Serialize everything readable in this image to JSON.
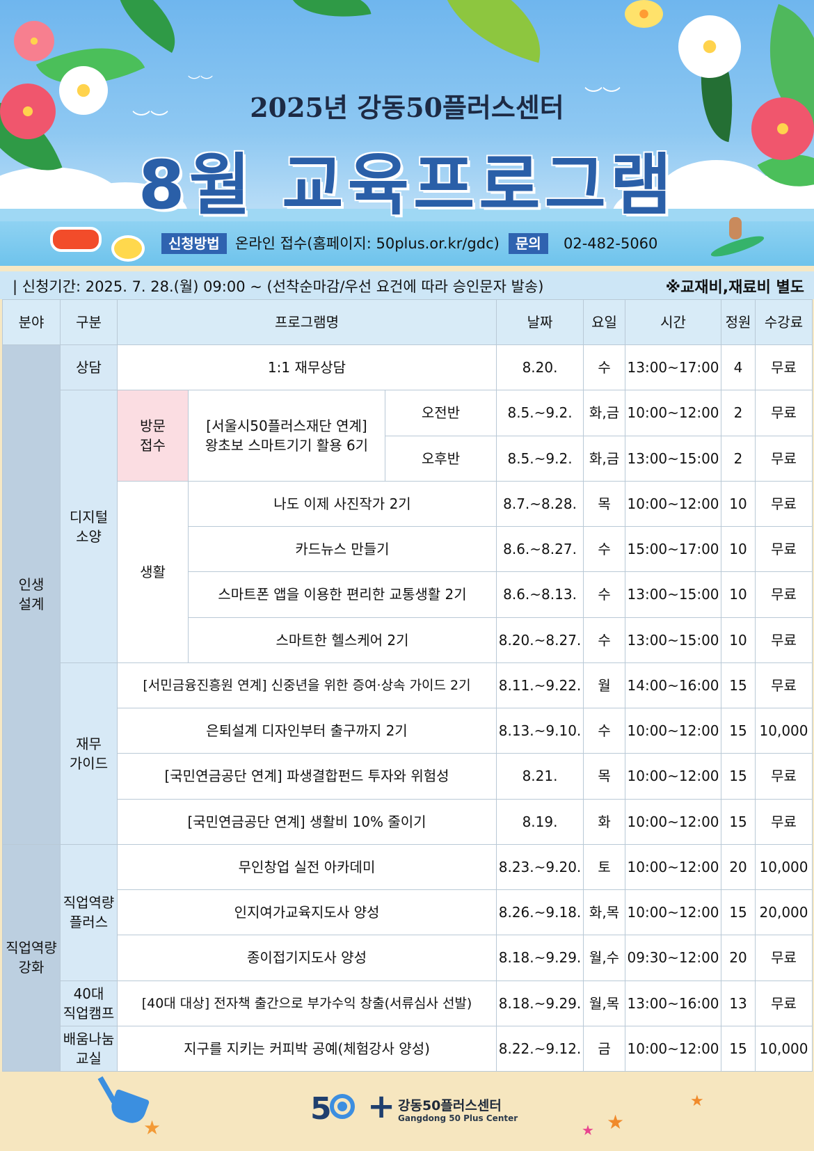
{
  "header": {
    "subtitle": "2025년 강동50플러스센터",
    "title": "8월 교육프로그램"
  },
  "contact": {
    "method_label": "신청방법",
    "method_text": "온라인 접수(홈페이지: 50plus.or.kr/gdc)",
    "inquiry_label": "문의",
    "inquiry_phone": "02-482-5060"
  },
  "period": {
    "text": "| 신청기간: 2025. 7. 28.(월) 09:00 ~ (선착순마감/우선 요건에 따라 승인문자 발송)",
    "note": "※교재비,재료비 별도"
  },
  "table": {
    "headers": {
      "field": "분야",
      "category": "구분",
      "program": "프로그램명",
      "date": "날짜",
      "day": "요일",
      "time": "시간",
      "capacity": "정원",
      "fee": "수강료"
    },
    "fields": {
      "life": "인생\n설계",
      "career": "직업역량\n강화"
    },
    "categories": {
      "counsel": "상담",
      "digital": "디지털\n소양",
      "visit": "방문\n접수",
      "living": "생활",
      "finance": "재무\n가이드",
      "career_plus": "직업역량\n플러스",
      "camp40": "40대\n직업캠프",
      "sharing": "배움나눔\n교실"
    },
    "rows": [
      {
        "program": "1:1 재무상담",
        "date": "8.20.",
        "day": "수",
        "time": "13:00~17:00",
        "cap": "4",
        "fee": "무료"
      },
      {
        "program": "[서울시50플러스재단 연계]\n왕초보 스마트기기 활용 6기",
        "session": "오전반",
        "date": "8.5.~9.2.",
        "day": "화,금",
        "time": "10:00~12:00",
        "cap": "2",
        "fee": "무료"
      },
      {
        "session": "오후반",
        "date": "8.5.~9.2.",
        "day": "화,금",
        "time": "13:00~15:00",
        "cap": "2",
        "fee": "무료"
      },
      {
        "program": "나도 이제 사진작가 2기",
        "date": "8.7.~8.28.",
        "day": "목",
        "time": "10:00~12:00",
        "cap": "10",
        "fee": "무료"
      },
      {
        "program": "카드뉴스 만들기",
        "date": "8.6.~8.27.",
        "day": "수",
        "time": "15:00~17:00",
        "cap": "10",
        "fee": "무료"
      },
      {
        "program": "스마트폰 앱을 이용한 편리한 교통생활 2기",
        "date": "8.6.~8.13.",
        "day": "수",
        "time": "13:00~15:00",
        "cap": "10",
        "fee": "무료"
      },
      {
        "program": "스마트한 헬스케어 2기",
        "date": "8.20.~8.27.",
        "day": "수",
        "time": "13:00~15:00",
        "cap": "10",
        "fee": "무료"
      },
      {
        "program": "[서민금융진흥원 연계] 신중년을 위한 증여·상속 가이드 2기",
        "date": "8.11.~9.22.",
        "day": "월",
        "time": "14:00~16:00",
        "cap": "15",
        "fee": "무료"
      },
      {
        "program": "은퇴설계 디자인부터 출구까지 2기",
        "date": "8.13.~9.10.",
        "day": "수",
        "time": "10:00~12:00",
        "cap": "15",
        "fee": "10,000"
      },
      {
        "program": "[국민연금공단 연계] 파생결합펀드 투자와 위험성",
        "date": "8.21.",
        "day": "목",
        "time": "10:00~12:00",
        "cap": "15",
        "fee": "무료"
      },
      {
        "program": "[국민연금공단 연계] 생활비 10% 줄이기",
        "date": "8.19.",
        "day": "화",
        "time": "10:00~12:00",
        "cap": "15",
        "fee": "무료"
      },
      {
        "program": "무인창업 실전 아카데미",
        "date": "8.23.~9.20.",
        "day": "토",
        "time": "10:00~12:00",
        "cap": "20",
        "fee": "10,000"
      },
      {
        "program": "인지여가교육지도사 양성",
        "date": "8.26.~9.18.",
        "day": "화,목",
        "time": "10:00~12:00",
        "cap": "15",
        "fee": "20,000"
      },
      {
        "program": "종이접기지도사 양성",
        "date": "8.18.~9.29.",
        "day": "월,수",
        "time": "09:30~12:00",
        "cap": "20",
        "fee": "무료"
      },
      {
        "program": "[40대 대상] 전자책 출간으로 부가수익 창출(서류심사 선발)",
        "date": "8.18.~9.29.",
        "day": "월,목",
        "time": "13:00~16:00",
        "cap": "13",
        "fee": "무료"
      },
      {
        "program": "지구를 지키는 커피박 공예(체험강사 양성)",
        "date": "8.22.~9.12.",
        "day": "금",
        "time": "10:00~12:00",
        "cap": "15",
        "fee": "10,000"
      }
    ]
  },
  "footer": {
    "logo_mark": "5",
    "logo_plus": "+",
    "center_name_ko": "강동50플러스센터",
    "center_name_en": "Gangdong 50 Plus Center"
  },
  "icons": [
    "leaf-icon",
    "hibiscus-icon",
    "seagull-icon",
    "swimmer-icon",
    "surfer-icon",
    "shovel-icon",
    "starfish-icon"
  ],
  "colors": {
    "title_blue": "#2a5fa8",
    "tag_blue": "#2f63b0",
    "sky": "#6fb6ee",
    "sand": "#f6e6bf",
    "visit_pink": "#fbdde2"
  }
}
